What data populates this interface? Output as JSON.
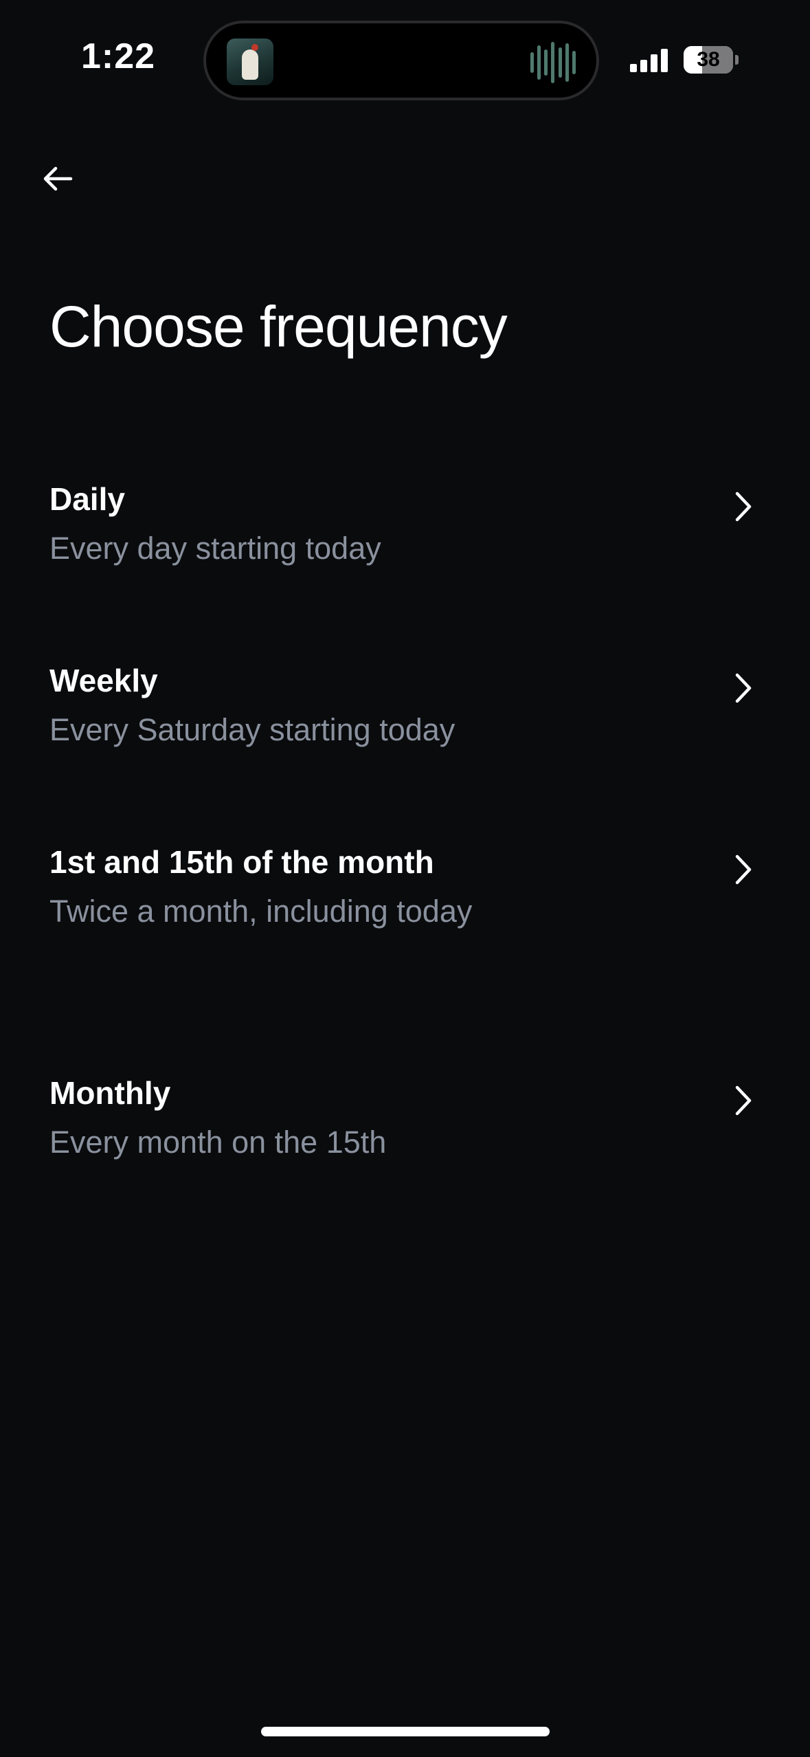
{
  "status_bar": {
    "time": "1:22",
    "battery": "38",
    "battery_fraction": 0.38,
    "signal_bars": 4,
    "now_playing_icon": "album-artwork-icon",
    "waveform_icon": "audio-waveform-icon"
  },
  "nav": {
    "back_icon": "arrow-left-icon"
  },
  "page": {
    "title": "Choose frequency"
  },
  "options": [
    {
      "title": "Daily",
      "subtitle": "Every day starting today"
    },
    {
      "title": "Weekly",
      "subtitle": "Every Saturday starting today"
    },
    {
      "title": "1st and 15th of the month",
      "subtitle": "Twice a month, including today"
    },
    {
      "title": "Monthly",
      "subtitle": "Every month on the 15th"
    }
  ],
  "colors": {
    "background": "#0a0b0d",
    "primary_text": "#ffffff",
    "secondary_text": "#8a919e"
  }
}
